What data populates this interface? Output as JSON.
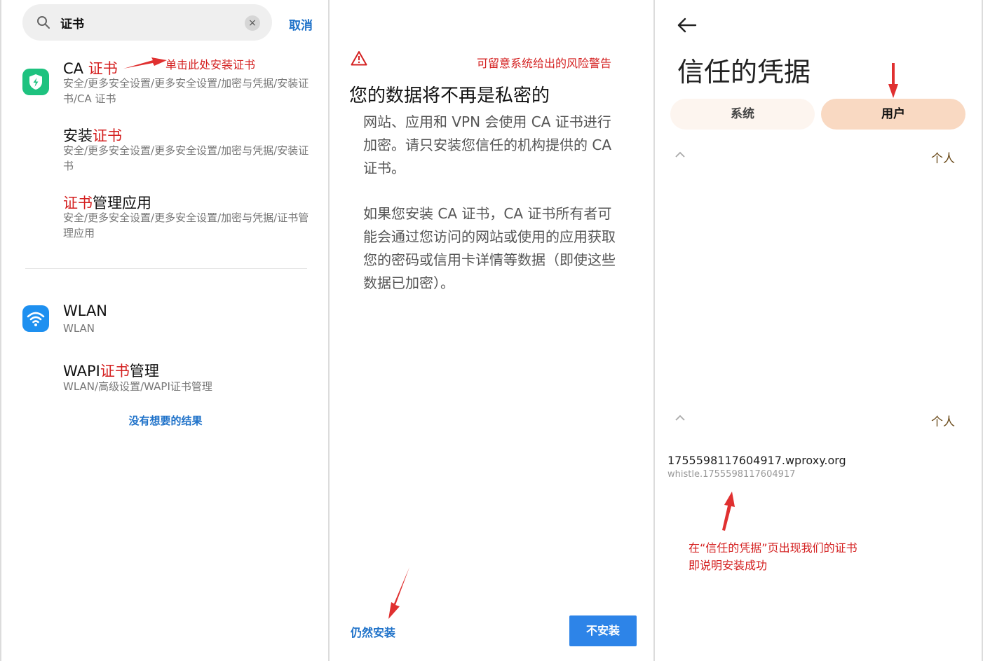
{
  "search": {
    "query": "证书",
    "clear_icon": "×",
    "cancel_label": "取消"
  },
  "results": [
    {
      "title_plain": "CA ",
      "title_highlight": "证书",
      "title_after": "",
      "path": "安全/更多安全设置/更多安全设置/加密与凭据/安装证书/CA 证书",
      "icon": "shield-icon"
    },
    {
      "title_plain": "安装",
      "title_highlight": "证书",
      "title_after": "",
      "path": "安全/更多安全设置/更多安全设置/加密与凭据/安装证书"
    },
    {
      "title_plain": "",
      "title_highlight": "证书",
      "title_after": "管理应用",
      "path": "安全/更多安全设置/更多安全设置/加密与凭据/证书管理应用"
    },
    {
      "title_plain": "WLAN",
      "title_highlight": "",
      "title_after": "",
      "path": "WLAN",
      "icon": "wifi-icon"
    },
    {
      "title_plain": "WAPI",
      "title_highlight": "证书",
      "title_after": "管理",
      "path": "WLAN/高级设置/WAPI证书管理"
    }
  ],
  "no_result_label": "没有想要的结果",
  "annotations": {
    "click_here": "单击此处安装证书",
    "risk_warning": "可留意系统给出的风险警告",
    "success_line1": "在“信任的凭据”页出现我们的证书",
    "success_line2": "即说明安装成功"
  },
  "warning_dialog": {
    "title": "您的数据将不再是私密的",
    "para1": "网站、应用和 VPN 会使用 CA 证书进行加密。请只安装您信任的机构提供的 CA 证书。",
    "para2": "如果您安装 CA 证书，CA 证书所有者可能会通过您访问的网站或使用的应用获取您的密码或信用卡详情等数据（即使这些数据已加密）。",
    "install_anyway": "仍然安装",
    "dont_install": "不安装"
  },
  "trusted_credentials": {
    "title": "信任的凭据",
    "tabs": [
      "系统",
      "用户"
    ],
    "active_tab": "用户",
    "section_label": "个人",
    "cert_name": "1755598117604917.wproxy.org",
    "cert_issuer": "whistle.1755598117604917"
  },
  "colors": {
    "accent_blue": "#1f72c9",
    "highlight_red": "#d42020",
    "active_tab_bg": "#f9d9c2"
  }
}
